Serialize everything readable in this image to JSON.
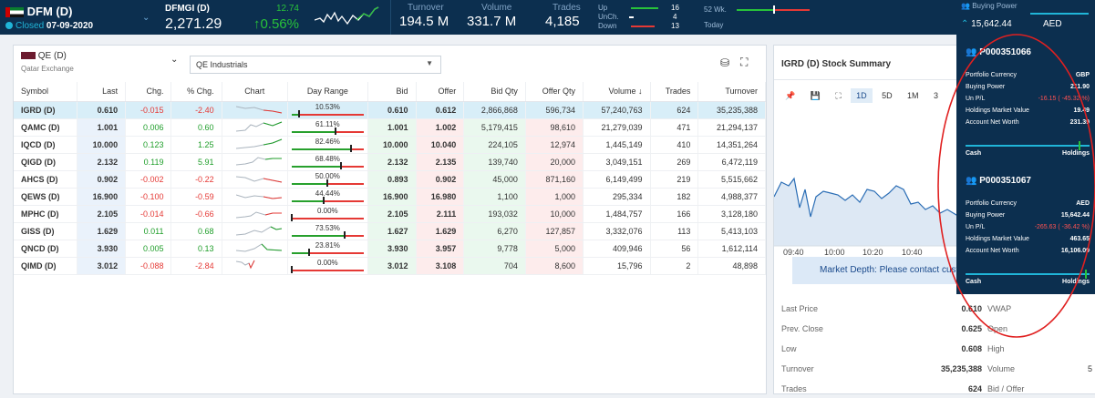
{
  "header": {
    "market": "DFM (D)",
    "status_prefix": "Closed",
    "status_date": "07-09-2020",
    "index_name": "DFMGI (D)",
    "index_value": "2,271.29",
    "index_change": "12.74",
    "index_change_pct": "↑0.56%",
    "turnover_label": "Turnover",
    "turnover": "194.5 M",
    "volume_label": "Volume",
    "volume": "331.7 M",
    "trades_label": "Trades",
    "trades": "4,185",
    "up_label": "Up",
    "unch_label": "UnCh.",
    "down_label": "Down",
    "up": "16",
    "unch": "4",
    "down": "13",
    "wk52_label": "52 Wk.",
    "today_label": "Today",
    "bp_label": "Buying Power",
    "bp_value": "15,642.44",
    "bp_currency": "AED"
  },
  "watchlist": {
    "exchange": "QE (D)",
    "exchange_sub": "Qatar Exchange",
    "sector": "QE Industrials",
    "columns": [
      "Symbol",
      "Last",
      "Chg.",
      "% Chg.",
      "Chart",
      "Day Range",
      "Bid",
      "Offer",
      "Bid Qty",
      "Offer Qty",
      "Volume ↓",
      "Trades",
      "Turnover"
    ],
    "rows": [
      {
        "symbol": "IGRD (D)",
        "last": "0.610",
        "chg": "-0.015",
        "pchg": "-2.40",
        "range": "10.53%",
        "range_pos": 0.1053,
        "bid": "0.610",
        "offer": "0.612",
        "bidqty": "2,866,868",
        "offqty": "596,734",
        "volume": "57,240,763",
        "trades": "624",
        "turnover": "35,235,388"
      },
      {
        "symbol": "QAMC (D)",
        "last": "1.001",
        "chg": "0.006",
        "pchg": "0.60",
        "range": "61.11%",
        "range_pos": 0.6111,
        "bid": "1.001",
        "offer": "1.002",
        "bidqty": "5,179,415",
        "offqty": "98,610",
        "volume": "21,279,039",
        "trades": "471",
        "turnover": "21,294,137"
      },
      {
        "symbol": "IQCD (D)",
        "last": "10.000",
        "chg": "0.123",
        "pchg": "1.25",
        "range": "82.46%",
        "range_pos": 0.8246,
        "bid": "10.000",
        "offer": "10.040",
        "bidqty": "224,105",
        "offqty": "12,974",
        "volume": "1,445,149",
        "trades": "410",
        "turnover": "14,351,264"
      },
      {
        "symbol": "QIGD (D)",
        "last": "2.132",
        "chg": "0.119",
        "pchg": "5.91",
        "range": "68.48%",
        "range_pos": 0.6848,
        "bid": "2.132",
        "offer": "2.135",
        "bidqty": "139,740",
        "offqty": "20,000",
        "volume": "3,049,151",
        "trades": "269",
        "turnover": "6,472,119"
      },
      {
        "symbol": "AHCS (D)",
        "last": "0.902",
        "chg": "-0.002",
        "pchg": "-0.22",
        "range": "50.00%",
        "range_pos": 0.5,
        "bid": "0.893",
        "offer": "0.902",
        "bidqty": "45,000",
        "offqty": "871,160",
        "volume": "6,149,499",
        "trades": "219",
        "turnover": "5,515,662"
      },
      {
        "symbol": "QEWS (D)",
        "last": "16.900",
        "chg": "-0.100",
        "pchg": "-0.59",
        "range": "44.44%",
        "range_pos": 0.4444,
        "bid": "16.900",
        "offer": "16.980",
        "bidqty": "1,100",
        "offqty": "1,000",
        "volume": "295,334",
        "trades": "182",
        "turnover": "4,988,377"
      },
      {
        "symbol": "MPHC (D)",
        "last": "2.105",
        "chg": "-0.014",
        "pchg": "-0.66",
        "range": "0.00%",
        "range_pos": 0,
        "bid": "2.105",
        "offer": "2.111",
        "bidqty": "193,032",
        "offqty": "10,000",
        "volume": "1,484,757",
        "trades": "166",
        "turnover": "3,128,180"
      },
      {
        "symbol": "GISS (D)",
        "last": "1.629",
        "chg": "0.011",
        "pchg": "0.68",
        "range": "73.53%",
        "range_pos": 0.7353,
        "bid": "1.627",
        "offer": "1.629",
        "bidqty": "6,270",
        "offqty": "127,857",
        "volume": "3,332,076",
        "trades": "113",
        "turnover": "5,413,103"
      },
      {
        "symbol": "QNCD (D)",
        "last": "3.930",
        "chg": "0.005",
        "pchg": "0.13",
        "range": "23.81%",
        "range_pos": 0.2381,
        "bid": "3.930",
        "offer": "3.957",
        "bidqty": "9,778",
        "offqty": "5,000",
        "volume": "409,946",
        "trades": "56",
        "turnover": "1,612,114"
      },
      {
        "symbol": "QIMD (D)",
        "last": "3.012",
        "chg": "-0.088",
        "pchg": "-2.84",
        "range": "0.00%",
        "range_pos": 0,
        "bid": "3.012",
        "offer": "3.108",
        "bidqty": "704",
        "offqty": "8,600",
        "volume": "15,796",
        "trades": "2",
        "turnover": "48,898"
      }
    ]
  },
  "summary": {
    "title": "IGRD (D) Stock Summary",
    "periods": [
      "1D",
      "5D",
      "1M",
      "3"
    ],
    "x_ticks": [
      "09:40",
      "10:00",
      "10:20",
      "10:40"
    ],
    "depth_msg": "Market Depth: Please contact custo",
    "stats_left": [
      {
        "label": "Last Price",
        "value": "0.610"
      },
      {
        "label": "Prev. Close",
        "value": "0.625"
      },
      {
        "label": "Low",
        "value": "0.608"
      },
      {
        "label": "Turnover",
        "value": "35,235,388"
      },
      {
        "label": "Trades",
        "value": "624"
      }
    ],
    "stats_right": [
      "VWAP",
      "Open",
      "High",
      "Volume",
      "Bid / Offer"
    ],
    "volume_right_partial": "5"
  },
  "portfolios": [
    {
      "id": "P000351066",
      "currency_label": "Portfolio Currency",
      "currency": "GBP",
      "bp_label": "Buying Power",
      "bp": "211.90",
      "upl_label": "Un P/L",
      "upl": "-16.15 ( -45.32 %)",
      "hmv_label": "Holdings Market Value",
      "hmv": "19.49",
      "anw_label": "Account Net Worth",
      "anw": "231.39",
      "cash_label": "Cash",
      "holdings_label": "Holdings",
      "cash_fraction": 0.92
    },
    {
      "id": "P000351067",
      "currency_label": "Portfolio Currency",
      "currency": "AED",
      "bp_label": "Buying Power",
      "bp": "15,642.44",
      "upl_label": "Un P/L",
      "upl": "-265.63 ( -36.42 %)",
      "hmv_label": "Holdings Market Value",
      "hmv": "463.65",
      "anw_label": "Account Net Worth",
      "anw": "16,106.09",
      "cash_label": "Cash",
      "holdings_label": "Holdings",
      "cash_fraction": 0.97
    }
  ],
  "colors": {
    "header_bg": "#0c2f4f",
    "up": "#1f9e2a",
    "down": "#e53935",
    "accent": "#20b5d8"
  }
}
